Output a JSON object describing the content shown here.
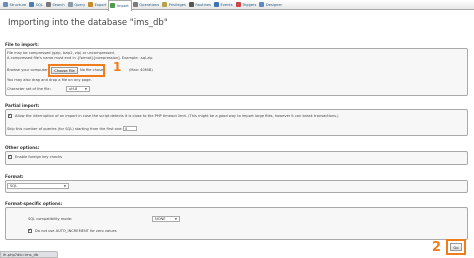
{
  "tabs": [
    {
      "label": "Structure",
      "icon": "structure-icon",
      "color": "#6a8fb5"
    },
    {
      "label": "SQL",
      "icon": "sql-icon",
      "color": "#4a7db0"
    },
    {
      "label": "Search",
      "icon": "search-icon",
      "color": "#7a7a7a"
    },
    {
      "label": "Query",
      "icon": "query-icon",
      "color": "#8a9aa8"
    },
    {
      "label": "Export",
      "icon": "export-icon",
      "color": "#c58c2b"
    },
    {
      "label": "Import",
      "icon": "import-icon",
      "color": "#4d9a4d",
      "active": true
    },
    {
      "label": "Operations",
      "icon": "operations-icon",
      "color": "#7b7b7b"
    },
    {
      "label": "Privileges",
      "icon": "privileges-icon",
      "color": "#b5a24a"
    },
    {
      "label": "Routines",
      "icon": "routines-icon",
      "color": "#555"
    },
    {
      "label": "Events",
      "icon": "events-icon",
      "color": "#3a74b8"
    },
    {
      "label": "Triggers",
      "icon": "triggers-icon",
      "color": "#c44"
    },
    {
      "label": "Designer",
      "icon": "designer-icon",
      "color": "#5b8ac4"
    }
  ],
  "page_title": "Importing into the database \"ims_db\"",
  "file_import": {
    "heading": "File to import:",
    "note1": "File may be compressed (gzip, bzip2, zip) or uncompressed.",
    "note2": "A compressed file's name must end in .[format].[compression]. Example: .sql.zip",
    "browse_label": "Browse your computer:",
    "choose_button": "Choose File",
    "no_file": "No file chosen",
    "max_size": "(Max: 40MiB)",
    "drag_note": "You may also drag and drop a file on any page.",
    "charset_label": "Character set of the file:",
    "charset_value": "utf-8"
  },
  "partial_import": {
    "heading": "Partial import:",
    "allow_interrupt": "Allow the interruption of an import in case the script detects it is close to the PHP timeout limit. (This might be a good way to import large files, however it can break transactions.)",
    "skip_label": "Skip this number of queries (for SQL) starting from the first one:",
    "skip_value": "0"
  },
  "other_options": {
    "heading": "Other options:",
    "foreign_keys": "Enable foreign key checks"
  },
  "format": {
    "heading": "Format:",
    "value": "SQL"
  },
  "format_specific": {
    "heading": "Format-specific options:",
    "compat_label": "SQL compatibility mode:",
    "compat_value": "NONE",
    "auto_inc": "Do not use AUTO_INCREMENT for zero values"
  },
  "annotations": {
    "step1": "1",
    "step2": "2",
    "color": "#f07c1c"
  },
  "go_button": "Go",
  "status_url": "lh.php?db=ims_db"
}
